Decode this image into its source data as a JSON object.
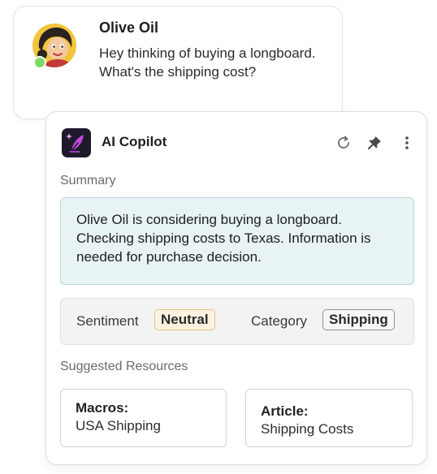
{
  "chat": {
    "name": "Olive Oil",
    "message": "Hey thinking of buying a longboard. What's the shipping cost?",
    "status_color": "#7fd667"
  },
  "copilot": {
    "title": "AI Copilot",
    "icons": {
      "logo": "quill-sparkle-icon",
      "refresh": "refresh-icon",
      "pin": "pin-icon",
      "more": "more-vertical-icon"
    },
    "summary_label": "Summary",
    "summary_text": "Olive Oil is considering buying a longboard. Checking shipping costs to Texas. Information is needed for purchase decision.",
    "sentiment_label": "Sentiment",
    "sentiment_value": "Neutral",
    "category_label": "Category",
    "category_value": "Shipping",
    "resources_label": "Suggested Resources",
    "resources": [
      {
        "type": "Macros:",
        "name": "USA Shipping"
      },
      {
        "type": "Article:",
        "name": "Shipping Costs"
      }
    ]
  },
  "colors": {
    "summary_bg": "#e8f3f4",
    "summary_border": "#b9d7da",
    "neutral_tag_bg": "#fbf3e0",
    "neutral_tag_border": "#e2c37b",
    "logo_bg": "#1e1a2c",
    "logo_accent": "#c24ad8"
  }
}
